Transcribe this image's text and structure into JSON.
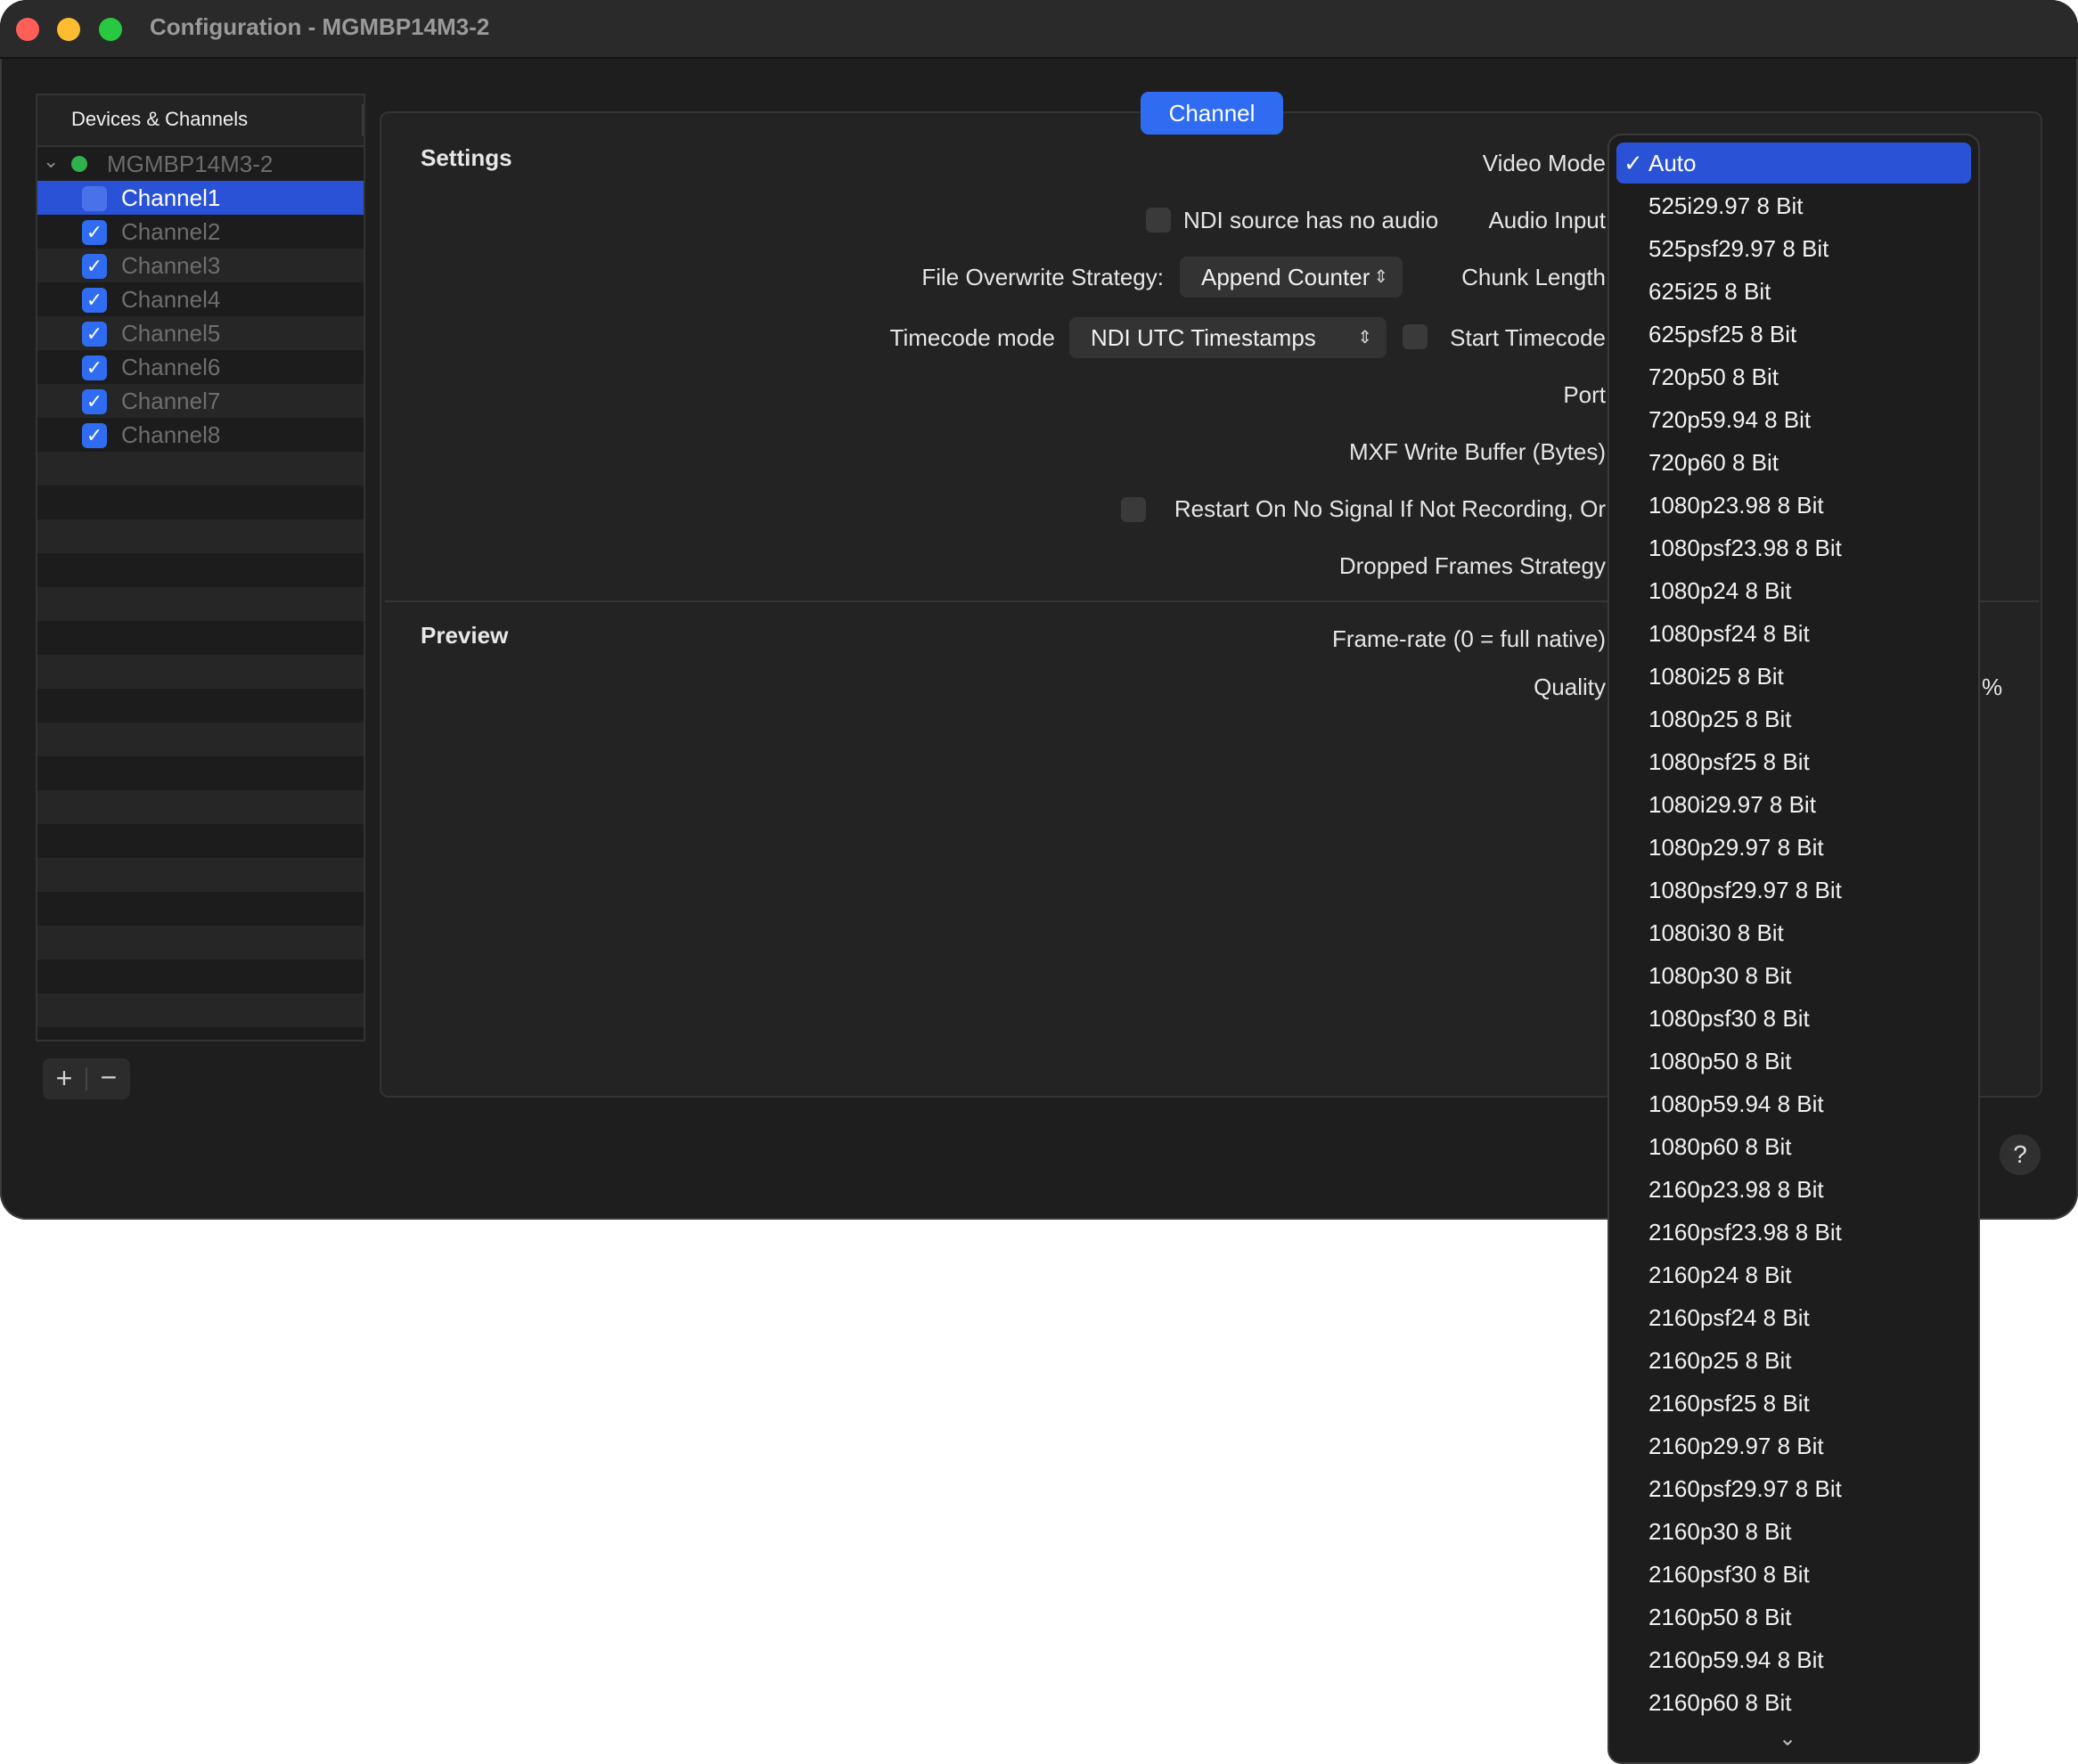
{
  "window": {
    "title": "Configuration - MGMBP14M3-2"
  },
  "sidebar": {
    "header": "Devices & Channels",
    "device": "MGMBP14M3-2",
    "channels": [
      {
        "label": "Channel1",
        "checked": false,
        "selected": true
      },
      {
        "label": "Channel2",
        "checked": true
      },
      {
        "label": "Channel3",
        "checked": true
      },
      {
        "label": "Channel4",
        "checked": true
      },
      {
        "label": "Channel5",
        "checked": true
      },
      {
        "label": "Channel6",
        "checked": true
      },
      {
        "label": "Channel7",
        "checked": true
      },
      {
        "label": "Channel8",
        "checked": true
      }
    ],
    "add_label": "+",
    "remove_label": "−"
  },
  "tabs": {
    "channel": "Channel"
  },
  "settings": {
    "title": "Settings",
    "video_mode_label": "Video Mode",
    "ndi_no_audio_label": "NDI source has no audio",
    "audio_input_label": "Audio Input",
    "file_overwrite_label": "File Overwrite Strategy:",
    "file_overwrite_value": "Append Counter",
    "chunk_length_label": "Chunk Length",
    "timecode_mode_label": "Timecode mode",
    "timecode_mode_value": "NDI UTC Timestamps",
    "start_timecode_label": "Start Timecode",
    "port_label": "Port",
    "mxf_buffer_label": "MXF Write Buffer (Bytes)",
    "restart_label": "Restart On No Signal If Not Recording, Or",
    "dropped_frames_label": "Dropped Frames Strategy"
  },
  "preview": {
    "title": "Preview",
    "framerate_label": "Frame-rate (0 = full native)",
    "quality_label": "Quality",
    "quality_unit": "%"
  },
  "help": "?",
  "video_mode_menu": {
    "selected": "Auto",
    "check": "✓",
    "items": [
      "Auto",
      "525i29.97 8 Bit",
      "525psf29.97 8 Bit",
      "625i25 8 Bit",
      "625psf25 8 Bit",
      "720p50 8 Bit",
      "720p59.94 8 Bit",
      "720p60 8 Bit",
      "1080p23.98 8 Bit",
      "1080psf23.98 8 Bit",
      "1080p24 8 Bit",
      "1080psf24 8 Bit",
      "1080i25 8 Bit",
      "1080p25 8 Bit",
      "1080psf25 8 Bit",
      "1080i29.97 8 Bit",
      "1080p29.97 8 Bit",
      "1080psf29.97 8 Bit",
      "1080i30 8 Bit",
      "1080p30 8 Bit",
      "1080psf30 8 Bit",
      "1080p50 8 Bit",
      "1080p59.94 8 Bit",
      "1080p60 8 Bit",
      "2160p23.98 8 Bit",
      "2160psf23.98 8 Bit",
      "2160p24 8 Bit",
      "2160psf24 8 Bit",
      "2160p25 8 Bit",
      "2160psf25 8 Bit",
      "2160p29.97 8 Bit",
      "2160psf29.97 8 Bit",
      "2160p30 8 Bit",
      "2160psf30 8 Bit",
      "2160p50 8 Bit",
      "2160p59.94 8 Bit",
      "2160p60 8 Bit"
    ],
    "more_icon": "chevron-down-icon"
  },
  "colors": {
    "accent": "#2f6cf2",
    "selection": "#2a52d6",
    "status_green": "#2fb24d"
  }
}
